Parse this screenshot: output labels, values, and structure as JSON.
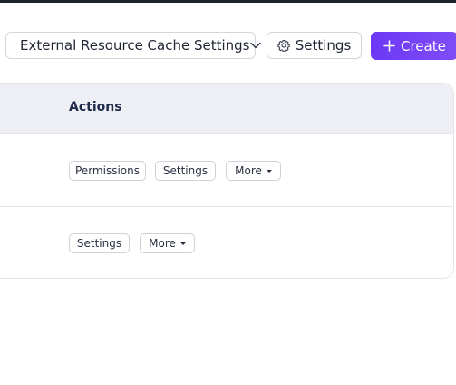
{
  "toolbar": {
    "cache_settings_label": "External Resource Cache Settings",
    "settings_label": "Settings",
    "create_label": "Create"
  },
  "table": {
    "columns": [
      "Actions"
    ],
    "rows": [
      {
        "actions": [
          "Permissions",
          "Settings",
          "More"
        ]
      },
      {
        "actions": [
          "Settings",
          "More"
        ]
      }
    ]
  },
  "colors": {
    "accent": "#6d38f5",
    "header_bg": "#eeeff5",
    "border": "#d3d6dd"
  },
  "icons": {
    "dropdown": "chevron-down-icon",
    "settings": "gear-icon",
    "create": "plus-icon",
    "more": "caret-down-icon"
  }
}
